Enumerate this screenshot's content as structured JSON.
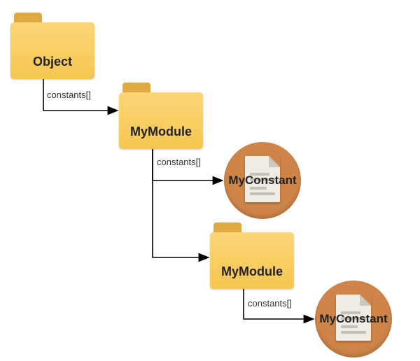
{
  "nodes": {
    "object": {
      "label": "Object",
      "type": "folder"
    },
    "mymodule1": {
      "label": "MyModule",
      "type": "folder"
    },
    "myconstant1": {
      "label": "MyConstant",
      "type": "document"
    },
    "mymodule2": {
      "label": "MyModule",
      "type": "folder"
    },
    "myconstant2": {
      "label": "MyConstant",
      "type": "document"
    }
  },
  "edges": {
    "e1": {
      "label": "constants[]"
    },
    "e2": {
      "label": "constants[]"
    },
    "e3": {
      "label": "constants[]"
    }
  }
}
